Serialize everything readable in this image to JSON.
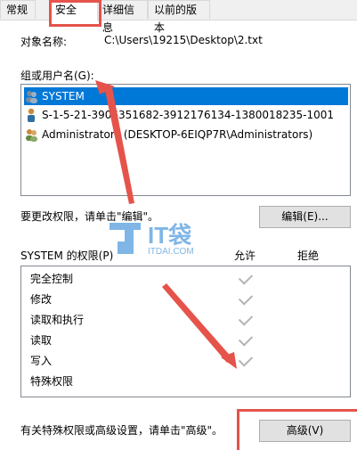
{
  "tabs": [
    {
      "label": "常规"
    },
    {
      "label": "安全"
    },
    {
      "label": "详细信息"
    },
    {
      "label": "以前的版本"
    }
  ],
  "object": {
    "label": "对象名称:",
    "value": "C:\\Users\\19215\\Desktop\\2.txt"
  },
  "groups": {
    "label": "组或用户名(G):",
    "items": [
      {
        "label": "SYSTEM"
      },
      {
        "label": "S-1-5-21-3906351682-3912176134-1380018235-1001"
      },
      {
        "label": "Administrators (DESKTOP-6EIQP7R\\Administrators)"
      }
    ]
  },
  "change_hint": "要更改权限，请单击\"编辑\"。",
  "edit_button": "编辑(E)...",
  "permissions": {
    "header": "SYSTEM 的权限(P)",
    "allow": "允许",
    "deny": "拒绝",
    "items": [
      {
        "label": "完全控制",
        "allow": true
      },
      {
        "label": "修改",
        "allow": true
      },
      {
        "label": "读取和执行",
        "allow": true
      },
      {
        "label": "读取",
        "allow": true
      },
      {
        "label": "写入",
        "allow": true
      },
      {
        "label": "特殊权限",
        "allow": false
      }
    ]
  },
  "advanced_hint": "有关特殊权限或高级设置，请单击\"高级\"。",
  "advanced_button": "高级(V)",
  "watermark": {
    "brand": "IT袋",
    "url": "ITDAI.COM"
  },
  "colors": {
    "selection": "#0078d7",
    "annotation": "#e5534b",
    "watermark": "#7fb6e6"
  }
}
